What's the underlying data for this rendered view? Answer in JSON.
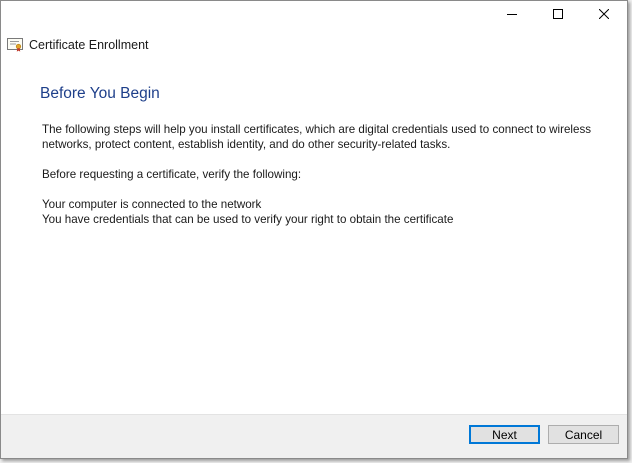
{
  "window": {
    "title": "Certificate Enrollment"
  },
  "page": {
    "heading": "Before You Begin",
    "paragraph1": "The following steps will help you install certificates, which are digital credentials used to connect to wireless networks, protect content, establish identity, and do other security-related tasks.",
    "paragraph2": "Before requesting a certificate, verify the following:",
    "requirements": [
      "Your computer is connected to the network",
      "You have credentials that can be used to verify your right to obtain the certificate"
    ]
  },
  "footer": {
    "next_label": "Next",
    "cancel_label": "Cancel"
  },
  "colors": {
    "heading": "#1e3f8a",
    "default_button_border": "#0078d7"
  }
}
